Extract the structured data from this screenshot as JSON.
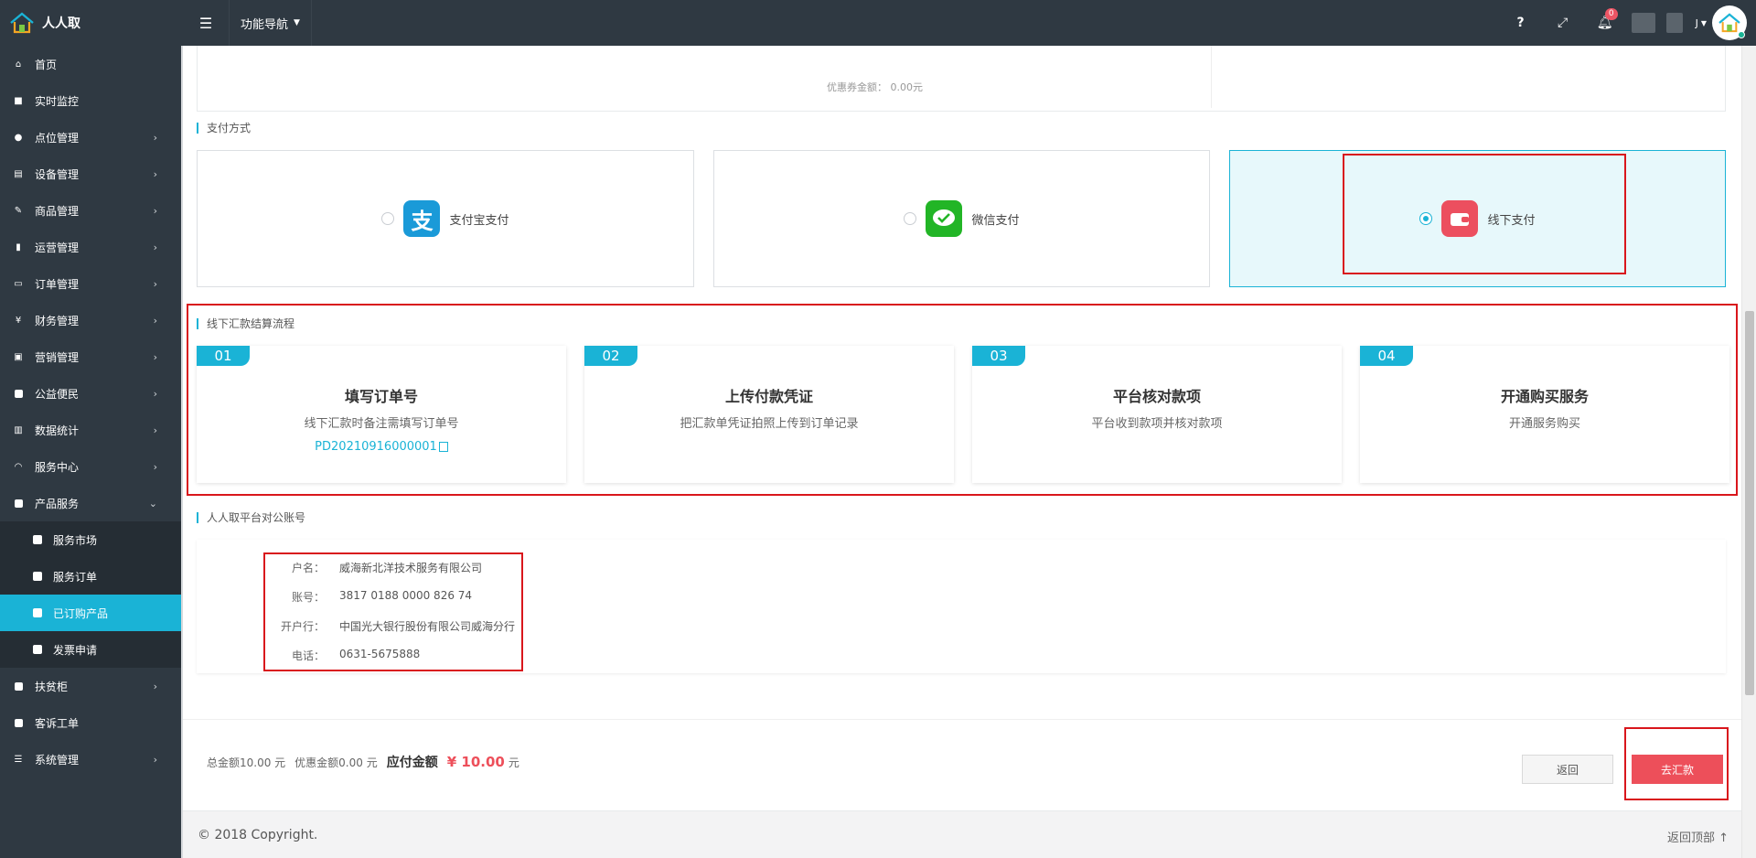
{
  "app": {
    "name": "人人取"
  },
  "topbar": {
    "nav_label": "功能导航",
    "help": "?",
    "notify_count": "0",
    "user_short": "J"
  },
  "sidebar": {
    "items": [
      {
        "label": "首页",
        "icon": "home-icon"
      },
      {
        "label": "实时监控",
        "icon": "video-icon"
      },
      {
        "label": "点位管理",
        "icon": "location-icon"
      },
      {
        "label": "设备管理",
        "icon": "device-icon"
      },
      {
        "label": "商品管理",
        "icon": "edit-icon"
      },
      {
        "label": "运营管理",
        "icon": "bookmark-icon"
      },
      {
        "label": "订单管理",
        "icon": "list-icon"
      },
      {
        "label": "财务管理",
        "icon": "yen-icon"
      },
      {
        "label": "营销管理",
        "icon": "gift-icon"
      },
      {
        "label": "公益便民",
        "icon": "square-icon"
      },
      {
        "label": "数据统计",
        "icon": "bar-chart-icon"
      },
      {
        "label": "服务中心",
        "icon": "headset-icon"
      },
      {
        "label": "产品服务",
        "icon": "square-icon"
      }
    ],
    "sub_items": [
      {
        "label": "服务市场"
      },
      {
        "label": "服务订单"
      },
      {
        "label": "已订购产品"
      },
      {
        "label": "发票申请"
      }
    ],
    "after_items": [
      {
        "label": "扶贫柜",
        "icon": "square-icon"
      },
      {
        "label": "客诉工单",
        "icon": "square-icon"
      },
      {
        "label": "系统管理",
        "icon": "list-icon"
      }
    ]
  },
  "top_card": {
    "faded_text": "优惠券金额：      0.00元"
  },
  "payment": {
    "section_title": "支付方式",
    "options": [
      {
        "label": "支付宝支付",
        "icon": "alipay-icon",
        "selected": false
      },
      {
        "label": "微信支付",
        "icon": "wechat-icon",
        "selected": false
      },
      {
        "label": "线下支付",
        "icon": "wallet-icon",
        "selected": true
      }
    ]
  },
  "process": {
    "section_title": "线下汇款结算流程",
    "steps": [
      {
        "num": "01",
        "title": "填写订单号",
        "desc": "线下汇款时备注需填写订单号",
        "link": "PD20210916000001"
      },
      {
        "num": "02",
        "title": "上传付款凭证",
        "desc": "把汇款单凭证拍照上传到订单记录"
      },
      {
        "num": "03",
        "title": "平台核对款项",
        "desc": "平台收到款项并核对款项"
      },
      {
        "num": "04",
        "title": "开通购买服务",
        "desc": "开通服务购买"
      }
    ]
  },
  "account": {
    "section_title": "人人取平台对公账号",
    "rows": [
      {
        "k": "户名：",
        "v": "威海新北洋技术服务有限公司"
      },
      {
        "k": "账号：",
        "v": "3817 0188 0000 826 74"
      },
      {
        "k": "开户行：",
        "v": "中国光大银行股份有限公司威海分行"
      },
      {
        "k": "电话：",
        "v": "0631-5675888"
      }
    ]
  },
  "summary": {
    "total": "总金额10.00 元",
    "discount": "优惠金额0.00 元",
    "payable_label": "应付金额",
    "payable_amount": "¥ 10.00",
    "unit": "元"
  },
  "buttons": {
    "back": "返回",
    "remit": "去汇款"
  },
  "footer": {
    "copyright": "© 2018 Copyright.",
    "back_top": "返回顶部"
  },
  "colors": {
    "accent": "#1ab3d6",
    "sidebar_bg": "#2f3942",
    "danger": "#ed4f5a",
    "highlight_border": "#d9161c"
  }
}
